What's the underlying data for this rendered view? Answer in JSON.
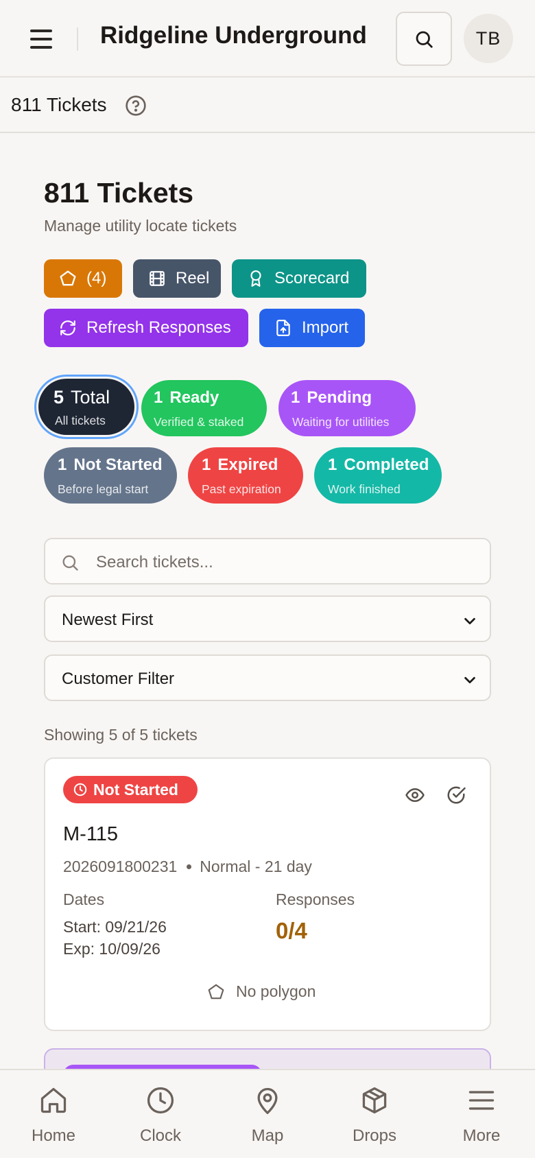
{
  "header": {
    "app_title": "Ridgeline Underground",
    "avatar_initials": "TB"
  },
  "subbar": {
    "title": "811 Tickets"
  },
  "page": {
    "title": "811 Tickets",
    "subtitle": "Manage utility locate tickets"
  },
  "actions": {
    "polygon_count": "(4)",
    "reel": "Reel",
    "scorecard": "Scorecard",
    "refresh": "Refresh Responses",
    "import": "Import"
  },
  "filters": [
    {
      "count": "5",
      "label": "Total",
      "sub": "All tickets",
      "color": "#1e2533"
    },
    {
      "count": "1",
      "label": "Ready",
      "sub": "Verified & staked",
      "color": "#22c55e"
    },
    {
      "count": "1",
      "label": "Pending",
      "sub": "Waiting for utilities",
      "color": "#a855f7"
    },
    {
      "count": "1",
      "label": "Not Started",
      "sub": "Before legal start",
      "color": "#64748b"
    },
    {
      "count": "1",
      "label": "Expired",
      "sub": "Past expiration",
      "color": "#ef4444"
    },
    {
      "count": "1",
      "label": "Completed",
      "sub": "Work finished",
      "color": "#14b8a6"
    }
  ],
  "search": {
    "placeholder": "Search tickets..."
  },
  "sort": {
    "selected": "Newest First"
  },
  "customer_filter": {
    "selected": "Customer Filter"
  },
  "showing_text": "Showing 5 of 5 tickets",
  "tickets": [
    {
      "status": "Not Started",
      "id": "M-115",
      "number": "2026091800231",
      "priority": "Normal - 21 day",
      "dates_label": "Dates",
      "start": "Start: 09/21/26",
      "exp": "Exp: 10/09/26",
      "responses_label": "Responses",
      "responses": "0/4",
      "polygon": "No polygon"
    }
  ],
  "bottom_nav": [
    {
      "label": "Home",
      "icon": "home-icon"
    },
    {
      "label": "Clock",
      "icon": "clock-icon"
    },
    {
      "label": "Map",
      "icon": "map-pin-icon"
    },
    {
      "label": "Drops",
      "icon": "package-icon"
    },
    {
      "label": "More",
      "icon": "menu-icon"
    }
  ],
  "colors": {
    "polygon_btn": "#d97706",
    "reel_btn": "#475569",
    "scorecard_btn": "#0d9488",
    "refresh_btn": "#9333ea",
    "import_btn": "#2563eb",
    "active_ring": "#60a5fa"
  }
}
